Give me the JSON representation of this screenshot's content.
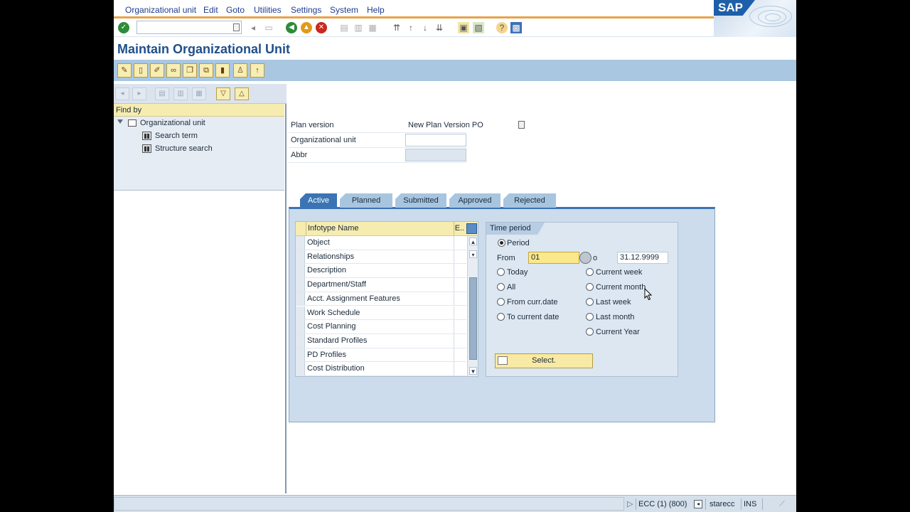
{
  "menu": {
    "items": [
      "Organizational unit",
      "Edit",
      "Goto",
      "Utilities",
      "Settings",
      "System",
      "Help"
    ]
  },
  "brand": {
    "logo_text": "SAP"
  },
  "page": {
    "title": "Maintain Organizational Unit"
  },
  "navigator": {
    "find_by": "Find by",
    "root": "Organizational unit",
    "children": [
      "Search term",
      "Structure search"
    ]
  },
  "form": {
    "plan_version_label": "Plan version",
    "plan_version_value": "New Plan Version PO",
    "org_unit_label": "Organizational unit",
    "org_unit_value": "",
    "abbr_label": "Abbr",
    "abbr_value": ""
  },
  "tabs": [
    "Active",
    "Planned",
    "Submitted",
    "Approved",
    "Rejected"
  ],
  "active_tab": "Active",
  "infotypes": {
    "header_name": "Infotype Name",
    "header_e": "E..",
    "rows": [
      "Object",
      "Relationships",
      "Description",
      "Department/Staff",
      "Acct. Assignment Features",
      "Work Schedule",
      "Cost Planning",
      "Standard Profiles",
      "PD Profiles",
      "Cost Distribution"
    ]
  },
  "time_period": {
    "header": "Time period",
    "period_label": "Period",
    "from_label": "From",
    "from_value": "01",
    "to_label": "o",
    "to_value": "31.12.9999",
    "left_options": [
      "Today",
      "All",
      "From curr.date",
      "To current date"
    ],
    "right_options": [
      "Current week",
      "Current month",
      "Last week",
      "Last month",
      "Current Year"
    ],
    "select_label": "Select."
  },
  "status": {
    "system": "ECC (1) (800)",
    "user": "starecc",
    "mode": "INS"
  },
  "colors": {
    "accent": "#3a74b4",
    "title": "#1f4f8a",
    "menu_underline": "#e8a24a",
    "highlight": "#f6ecb0"
  }
}
